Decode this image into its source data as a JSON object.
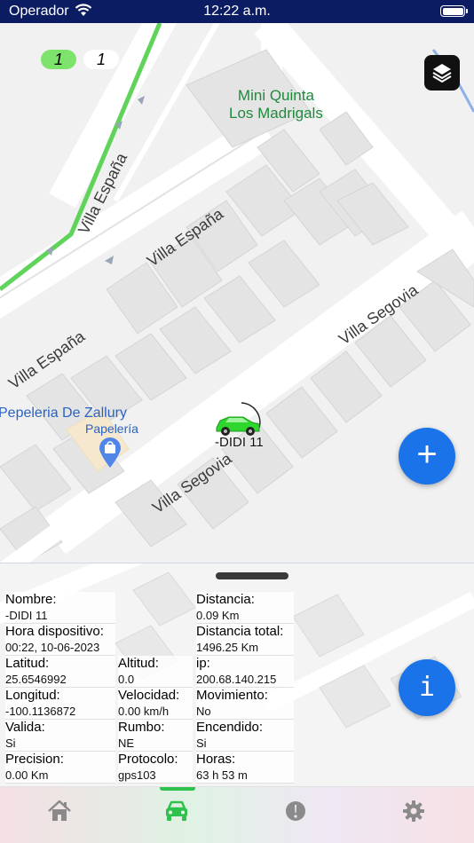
{
  "status_bar": {
    "carrier": "Operador",
    "time": "12:22 a.m."
  },
  "map": {
    "counters": [
      "1",
      "1"
    ],
    "streets": [
      "Villa España",
      "Villa España",
      "Villa España",
      "Villa Segovia",
      "Villa Segovia"
    ],
    "poi_green": "Mini Quinta\nLos Madrigals",
    "poi_blue": "Pepeleria De Zallury",
    "poi_blue_sub": "Papelería",
    "vehicle_label": "-DIDI 11",
    "route_color": "#5fd35a",
    "vehicle_color": "#2ed62e"
  },
  "info": {
    "nombre": {
      "label": "Nombre:",
      "value": "-DIDI 11"
    },
    "hora": {
      "label": "Hora dispositivo:",
      "value": "00:22, 10-06-2023"
    },
    "latitud": {
      "label": "Latitud:",
      "value": "25.6546992"
    },
    "altitud": {
      "label": "Altitud:",
      "value": "0.0"
    },
    "longitud": {
      "label": "Longitud:",
      "value": "-100.1136872"
    },
    "velocidad": {
      "label": "Velocidad:",
      "value": "0.00 km/h"
    },
    "valida": {
      "label": "Valida:",
      "value": "Si"
    },
    "rumbo": {
      "label": "Rumbo:",
      "value": "NE"
    },
    "precision": {
      "label": "Precision:",
      "value": "0.00 Km"
    },
    "protocolo": {
      "label": "Protocolo:",
      "value": "gps103"
    },
    "distancia": {
      "label": "Distancia:",
      "value": "0.09 Km"
    },
    "distancia_total": {
      "label": "Distancia total:",
      "value": "1496.25 Km"
    },
    "ip": {
      "label": "ip:",
      "value": "200.68.140.215"
    },
    "movimiento": {
      "label": "Movimiento:",
      "value": "No"
    },
    "encendido": {
      "label": "Encendido:",
      "value": "Si"
    },
    "horas": {
      "label": "Horas:",
      "value": "63 h 53 m"
    }
  },
  "buttons": {
    "add": "+",
    "info": "i"
  },
  "nav": {
    "items": [
      "home-icon",
      "car-icon",
      "alert-icon",
      "gear-icon"
    ],
    "active_color": "#2ec24c",
    "inactive_color": "#8a8a8a"
  }
}
